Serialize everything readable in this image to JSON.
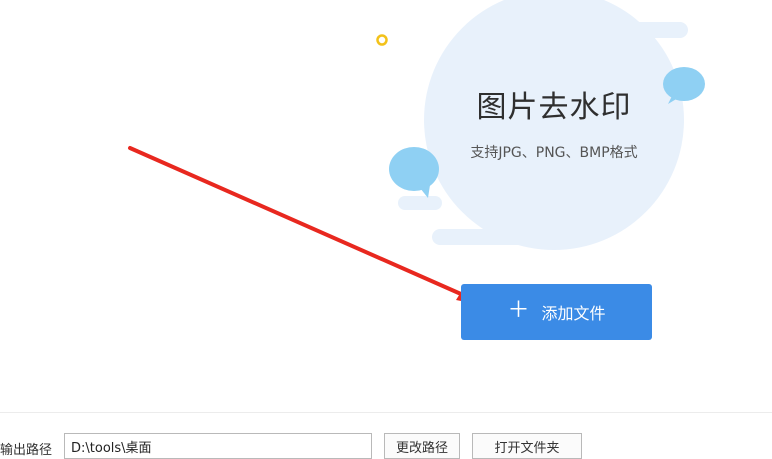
{
  "hero": {
    "title": "图片去水印",
    "subtitle": "支持JPG、PNG、BMP格式"
  },
  "actions": {
    "add_file_label": "添加文件",
    "add_file_icon": "plus-icon"
  },
  "output": {
    "label": "输出路径",
    "path_value": "D:\\tools\\桌面",
    "change_path_label": "更改路径",
    "open_folder_label": "打开文件夹"
  },
  "colors": {
    "accent": "#3b8be6",
    "circle": "#e8f1fb",
    "bubble": "#8fd0f3",
    "arrow": "#e8281f",
    "dot": "#f3c21a"
  }
}
